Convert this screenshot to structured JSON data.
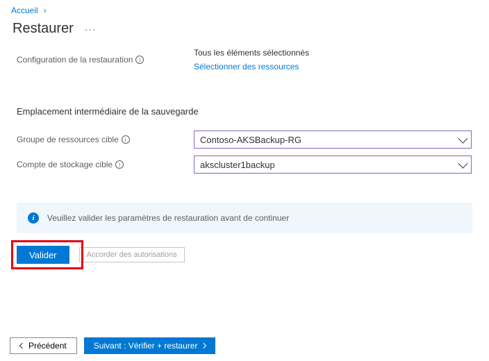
{
  "breadcrumb": {
    "home": "Accueil"
  },
  "header": {
    "title": "Restaurer"
  },
  "config": {
    "label": "Configuration de la restauration",
    "value": "Tous les éléments sélectionnés",
    "link": "Sélectionner des ressources"
  },
  "staging": {
    "title": "Emplacement intermédiaire de la sauvegarde",
    "rg_label": "Groupe de ressources cible",
    "rg_value": "Contoso-AKSBackup-RG",
    "sa_label": "Compte de stockage cible",
    "sa_value": "akscluster1backup"
  },
  "banner": {
    "text": "Veuillez valider les paramètres de restauration avant de continuer"
  },
  "actions": {
    "validate": "Valider",
    "grant": "Accorder des autorisations"
  },
  "footer": {
    "prev": "Précédent",
    "next": "Suivant : Vérifier +  restaurer"
  }
}
